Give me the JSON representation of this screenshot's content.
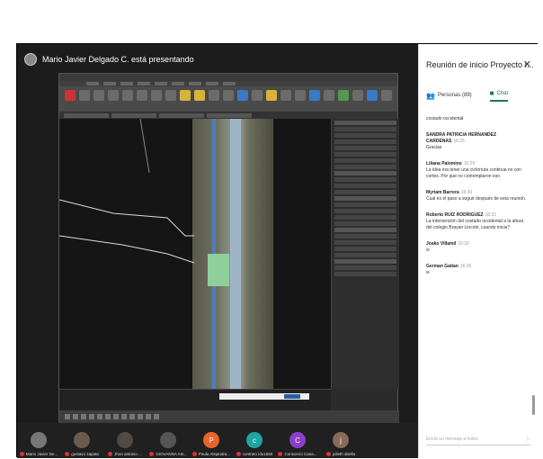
{
  "presenter": {
    "text": "Mario Javier Delgado C. está presentando"
  },
  "panel": {
    "title": "Reunión de inicio Proyecto I...",
    "tabs": [
      {
        "label": "Personas (89)"
      },
      {
        "label": "Chat"
      }
    ],
    "messages": [
      {
        "author": "",
        "time": "",
        "text": "costado occidental"
      },
      {
        "author": "SANDRA PATRICIA HERNANDEZ CARDENAS",
        "time": "16:25",
        "text": "Gracias"
      },
      {
        "author": "Liliana Palomino",
        "time": "16:29",
        "text": "La idea era tener una ciclorruta continua no con cortes. Por que no contemplaron eso"
      },
      {
        "author": "Myriam Barrera",
        "time": "16:30",
        "text": "Cual es el paso a seguir después de esta reunión."
      },
      {
        "author": "Roberto RUIZ RODRIGUEZ",
        "time": "16:31",
        "text": "La intervención del costado occidental a la altura del colegio Brayan Lincoln, cuando inicia?"
      },
      {
        "author": "Joako Villamil",
        "time": "16:33",
        "text": "si"
      },
      {
        "author": "German Gaitan",
        "time": "16:35",
        "text": "si"
      }
    ],
    "input_placeholder": "Envía un mensaje a todos"
  },
  "participants": [
    {
      "name": "Mario Javier De...",
      "initial": "",
      "color": "#777777"
    },
    {
      "name": "gustavo zapata",
      "initial": "",
      "color": "#6b5a4e"
    },
    {
      "name": "Jhon antonio ...",
      "initial": "",
      "color": "#4e4a44"
    },
    {
      "name": "GIOVANNA AN...",
      "initial": "",
      "color": "#555555"
    },
    {
      "name": "Paula Alejandra...",
      "initial": "P",
      "color": "#e8642c"
    },
    {
      "name": "contrato idu1650",
      "initial": "c",
      "color": "#1fa3a3"
    },
    {
      "name": "Consorcio Cana...",
      "initial": "C",
      "color": "#8a3fc7"
    },
    {
      "name": "julieth abella",
      "initial": "j",
      "color": "#8a6a5a"
    }
  ]
}
